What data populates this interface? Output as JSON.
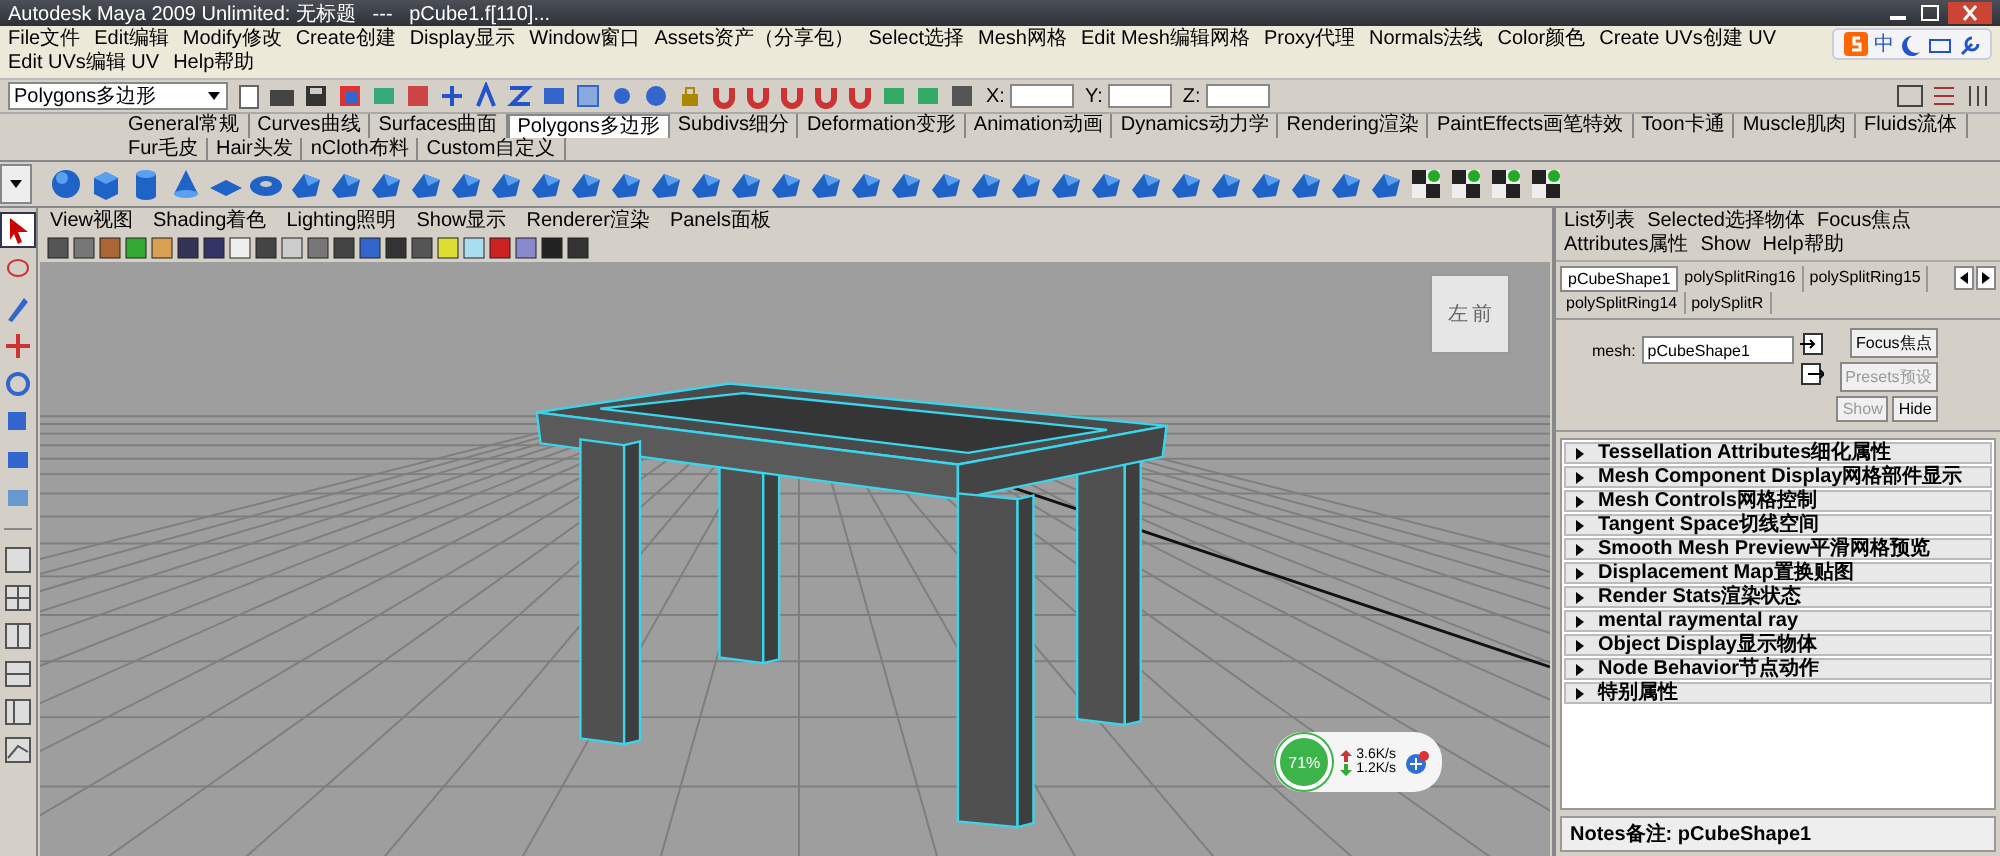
{
  "window": {
    "title": "Autodesk Maya 2009 Unlimited: 无标题   ---   pCube1.f[110]..."
  },
  "menu_bar": [
    "File文件",
    "Edit编辑",
    "Modify修改",
    "Create创建",
    "Display显示",
    "Window窗口",
    "Assets资产（分享包）",
    "Select选择",
    "Mesh网格",
    "Edit Mesh编辑网格",
    "Proxy代理",
    "Normals法线",
    "Color颜色",
    "Create UVs创建 UV",
    "Edit UVs编辑 UV",
    "Help帮助"
  ],
  "ime_toolbar": {
    "label": "中"
  },
  "status_line": {
    "mode": "Polygons多边形",
    "coords": [
      {
        "label": "X:"
      },
      {
        "label": "Y:"
      },
      {
        "label": "Z:"
      }
    ]
  },
  "shelf_tabs": [
    {
      "label": "General常规",
      "selected": false
    },
    {
      "label": "Curves曲线",
      "selected": false
    },
    {
      "label": "Surfaces曲面",
      "selected": false
    },
    {
      "label": "Polygons多边形",
      "selected": true
    },
    {
      "label": "Subdivs细分",
      "selected": false
    },
    {
      "label": "Deformation变形",
      "selected": false
    },
    {
      "label": "Animation动画",
      "selected": false
    },
    {
      "label": "Dynamics动力学",
      "selected": false
    },
    {
      "label": "Rendering渲染",
      "selected": false
    },
    {
      "label": "PaintEffects画笔特效",
      "selected": false
    },
    {
      "label": "Toon卡通",
      "selected": false
    },
    {
      "label": "Muscle肌肉",
      "selected": false
    },
    {
      "label": "Fluids流体",
      "selected": false
    },
    {
      "label": "Fur毛皮",
      "selected": false
    },
    {
      "label": "Hair头发",
      "selected": false
    },
    {
      "label": "nCloth布料",
      "selected": false
    },
    {
      "label": "Custom自定义",
      "selected": false
    }
  ],
  "panel_menu": [
    "View视图",
    "Shading着色",
    "Lighting照明",
    "Show显示",
    "Renderer渲染",
    "Panels面板"
  ],
  "view_cube": {
    "left": "左",
    "front": "前"
  },
  "hud": {
    "percent": "71%",
    "upload": "3.6K/s",
    "download": "1.2K/s"
  },
  "attribute_editor": {
    "menu": [
      "List列表",
      "Selected选择物体",
      "Focus焦点",
      "Attributes属性",
      "Show",
      "Help帮助"
    ],
    "tabs": [
      {
        "label": "pCubeShape1",
        "selected": true
      },
      {
        "label": "polySplitRing16",
        "selected": false
      },
      {
        "label": "polySplitRing15",
        "selected": false
      },
      {
        "label": "polySplitRing14",
        "selected": false
      },
      {
        "label": "polySplitR",
        "selected": false
      }
    ],
    "mesh_label": "mesh:",
    "mesh_value": "pCubeShape1",
    "buttons": [
      {
        "label": "Focus焦点",
        "disabled": false
      },
      {
        "label": "Presets预设",
        "disabled": true
      },
      {
        "label": "Show",
        "disabled": true
      },
      {
        "label": "Hide",
        "disabled": false
      }
    ],
    "sections": [
      {
        "label": "Tessellation Attributes细化属性",
        "expanded": false
      },
      {
        "label": "Mesh Component Display网格部件显示",
        "expanded": false
      },
      {
        "label": "Mesh Controls网格控制",
        "expanded": false
      },
      {
        "label": "Tangent Space切线空间",
        "expanded": false
      },
      {
        "label": "Smooth Mesh Preview平滑网格预览",
        "expanded": false
      },
      {
        "label": "Displacement Map置换贴图",
        "expanded": false
      },
      {
        "label": "Render Stats渲染状态",
        "expanded": false
      },
      {
        "label": "mental raymental ray",
        "expanded": false
      },
      {
        "label": "Object Display显示物体",
        "expanded": false
      },
      {
        "label": "Node Behavior节点动作",
        "expanded": false
      },
      {
        "label": "特别属性",
        "expanded": false
      }
    ],
    "notes": "Notes备注: pCubeShape1"
  }
}
